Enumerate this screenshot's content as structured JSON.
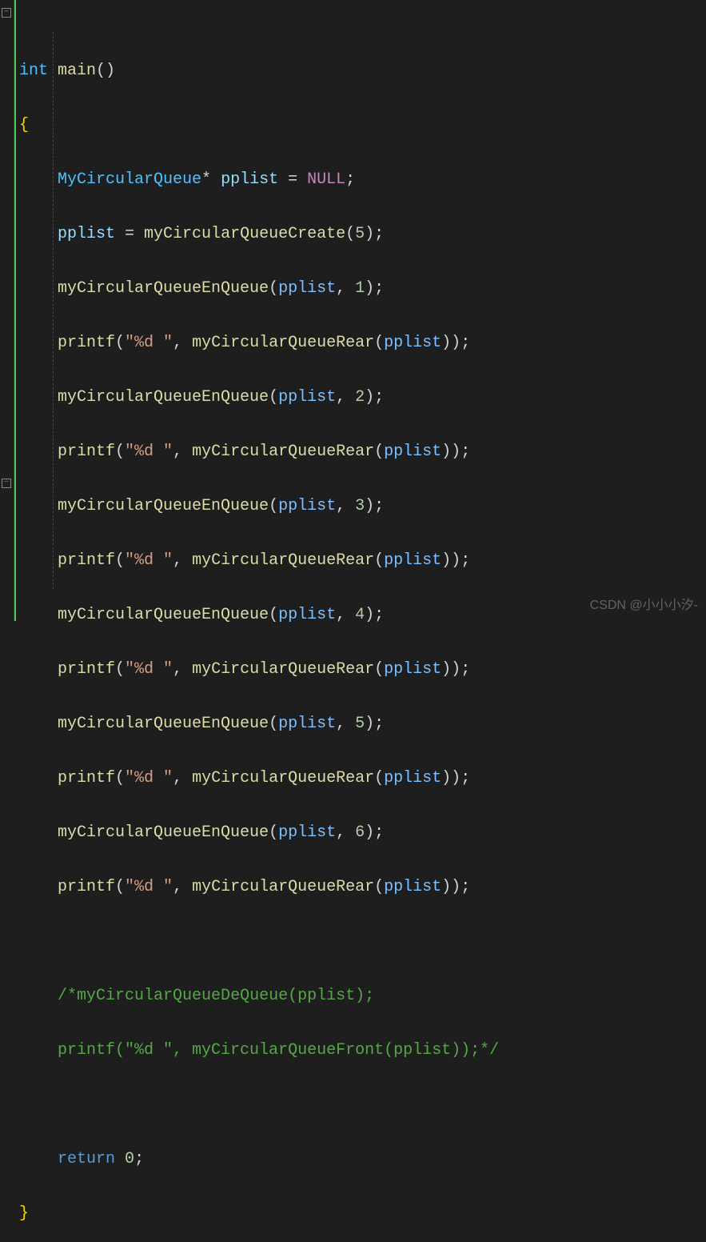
{
  "colors": {
    "background": "#1e1e1e",
    "type": "#4fc1ff",
    "keyword": "#569cd6",
    "function": "#dcdcaa",
    "variable": "#9cdcfe",
    "param": "#7fbfff",
    "string": "#d69d85",
    "number": "#b5cea8",
    "null": "#c586c0",
    "brace": "#ffd700",
    "comment": "#57a64a",
    "gutter_accent": "#4ec957"
  },
  "fold": {
    "minus": "−",
    "plus": "+"
  },
  "code": {
    "sig_type": "int",
    "sig_name": "main",
    "open_paren": "()",
    "brace_open": "{",
    "brace_close": "}",
    "decl_type": "MyCircularQueue",
    "star": "*",
    "var": "pplist",
    "eq": " = ",
    "null": "NULL",
    "semi": ";",
    "fn_create": "myCircularQueueCreate",
    "fn_enqueue": "myCircularQueueEnQueue",
    "fn_rear": "myCircularQueueRear",
    "fn_front": "myCircularQueueFront",
    "fn_dequeue": "myCircularQueueDeQueue",
    "fn_printf": "printf",
    "lparen": "(",
    "rparen": ")",
    "comma": ", ",
    "fmt": "\"%d \"",
    "n_create": "5",
    "n1": "1",
    "n2": "2",
    "n3": "3",
    "n4": "4",
    "n5": "5",
    "n6": "6",
    "ret": "return",
    "zero": "0",
    "comment_open": "/*",
    "comment_close": "*/",
    "comment_line1": "myCircularQueueDeQueue(pplist);",
    "comment_line2": "printf(\"%d \", myCircularQueueFront(pplist));"
  },
  "watermark": "CSDN @小小小汐-"
}
